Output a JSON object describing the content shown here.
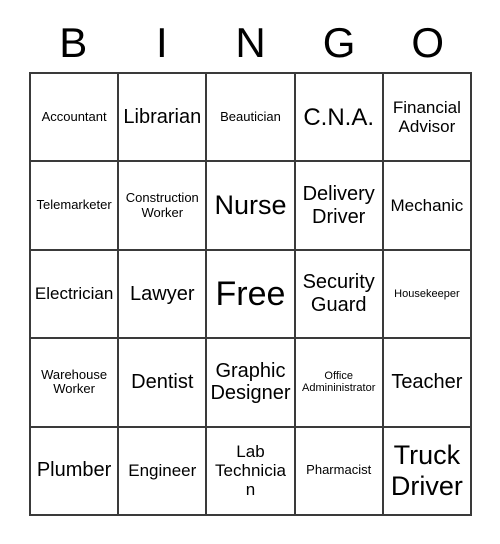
{
  "card": {
    "title": "BINGO",
    "header_letters": [
      "B",
      "I",
      "N",
      "G",
      "O"
    ],
    "columns": 5,
    "rows": 5,
    "free_space_label": "Free",
    "free_space_position": {
      "row": 3,
      "column": 3
    },
    "colors": {
      "background": "#ffffff",
      "text": "#000000",
      "border": "#3a3a3a"
    },
    "cells": [
      [
        {
          "label": "Accountant",
          "size": "s"
        },
        {
          "label": "Librarian",
          "size": "l"
        },
        {
          "label": "Beautician",
          "size": "s"
        },
        {
          "label": "C.N.A.",
          "size": "xl"
        },
        {
          "label": "Financial Advisor",
          "size": "m"
        }
      ],
      [
        {
          "label": "Telemarketer",
          "size": "s"
        },
        {
          "label": "Construction Worker",
          "size": "s"
        },
        {
          "label": "Nurse",
          "size": "xxl"
        },
        {
          "label": "Delivery Driver",
          "size": "l"
        },
        {
          "label": "Mechanic",
          "size": "m"
        }
      ],
      [
        {
          "label": "Electrician",
          "size": "m"
        },
        {
          "label": "Lawyer",
          "size": "l"
        },
        {
          "label": "Free",
          "size": "free"
        },
        {
          "label": "Security Guard",
          "size": "l"
        },
        {
          "label": "Housekeeper",
          "size": "xs"
        }
      ],
      [
        {
          "label": "Warehouse Worker",
          "size": "s"
        },
        {
          "label": "Dentist",
          "size": "l"
        },
        {
          "label": "Graphic Designer",
          "size": "l"
        },
        {
          "label": "Office Admininistrator",
          "size": "xs"
        },
        {
          "label": "Teacher",
          "size": "l"
        }
      ],
      [
        {
          "label": "Plumber",
          "size": "l"
        },
        {
          "label": "Engineer",
          "size": "m"
        },
        {
          "label": "Lab Technician",
          "size": "m"
        },
        {
          "label": "Pharmacist",
          "size": "s"
        },
        {
          "label": "Truck Driver",
          "size": "xxl"
        }
      ]
    ]
  }
}
